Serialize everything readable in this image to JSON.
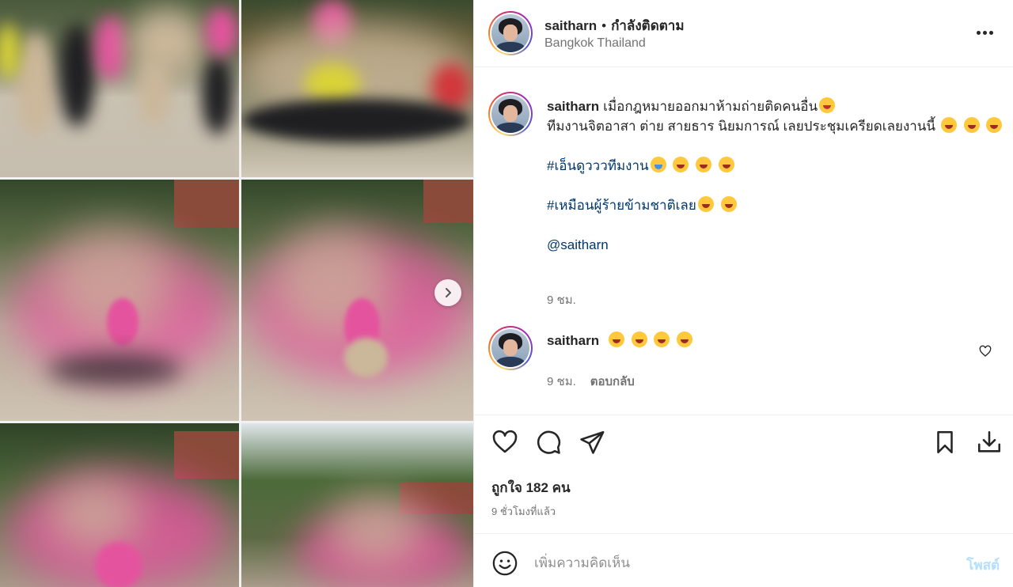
{
  "post": {
    "username": "saitharn",
    "dot": "•",
    "follow_state": "กำลังติดตาม",
    "location": "Bangkok Thailand"
  },
  "caption": {
    "username": "saitharn",
    "line1": "เมื่อกฎหมายออกมาห้ามถ่ายติดคนอื่น",
    "line2": "ทีมงานจิตอาสา ต่าย สายธาร นิยมการณ์ เลยประชุมเครียดเลยงานนี้",
    "hashtag1": "#เอ็นดูวววทีมงาน",
    "hashtag2": "#เหมือนผู้ร้ายข้ามชาติเลย",
    "mention": "@saitharn",
    "time": "9 ชม."
  },
  "reply_comment": {
    "username": "saitharn",
    "time": "9 ชม.",
    "reply_label": "ตอบกลับ"
  },
  "likes_text": "ถูกใจ 182 คน",
  "posted_ago": "9 ชั่วโมงที่แล้ว",
  "add_comment": {
    "placeholder": "เพิ่มความคิดเห็น",
    "post_label": "โพสต์"
  },
  "icons": {
    "more": "more-horizontal-icon",
    "like": "heart-icon",
    "comment": "comment-bubble-icon",
    "share": "paper-plane-icon",
    "save": "bookmark-icon",
    "download": "download-icon",
    "emoji": "smiley-icon",
    "next": "chevron-right-icon"
  }
}
